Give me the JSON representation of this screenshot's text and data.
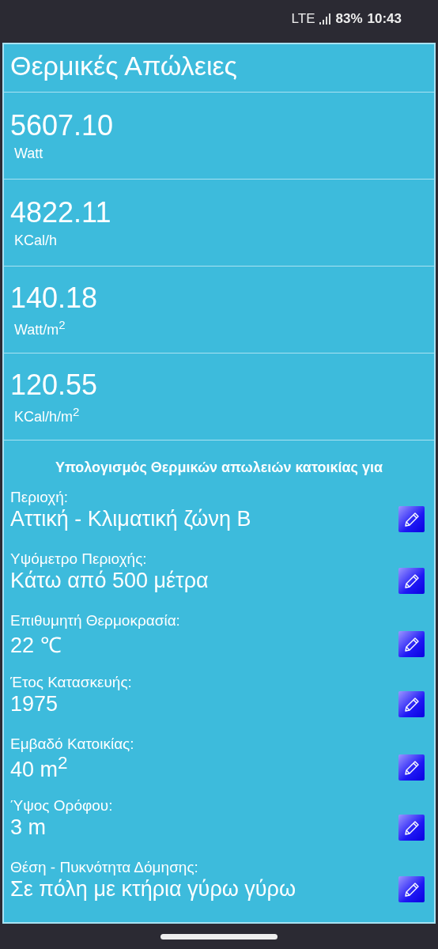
{
  "status_bar": {
    "network": "LTE",
    "battery": "83%",
    "time": "10:43"
  },
  "title": "Θερμικές Απώλειες",
  "results": [
    {
      "value": "5607.10",
      "unit": "Watt"
    },
    {
      "value": "4822.11",
      "unit": "KCal/h"
    },
    {
      "value": "140.18",
      "unit": "Watt/m$^{2}$"
    },
    {
      "value": "120.55",
      "unit": "KCal/h/m$^{2}$"
    }
  ],
  "section_heading": "Υπολογισμός Θερμικών απωλειών κατοικίας για",
  "parameters": [
    {
      "label": "Περιοχή:",
      "value": "Αττική - Κλιματική ζώνη Β"
    },
    {
      "label": "Υψόμετρο Περιοχής:",
      "value": "Κάτω από 500 μέτρα"
    },
    {
      "label": "Επιθυμητή Θερμοκρασία:",
      "value": "22 ℃"
    },
    {
      "label": "Έτος Κατασκευής:",
      "value": "1975"
    },
    {
      "label": "Εμβαδό Κατοικίας:",
      "value": "40 m$^{2}$"
    },
    {
      "label": "Ύψος Ορόφου:",
      "value": "3 m"
    },
    {
      "label": "Θέση - Πυκνότητα Δόμησης:",
      "value": "Σε πόλη με κτήρια γύρω γύρω"
    }
  ]
}
